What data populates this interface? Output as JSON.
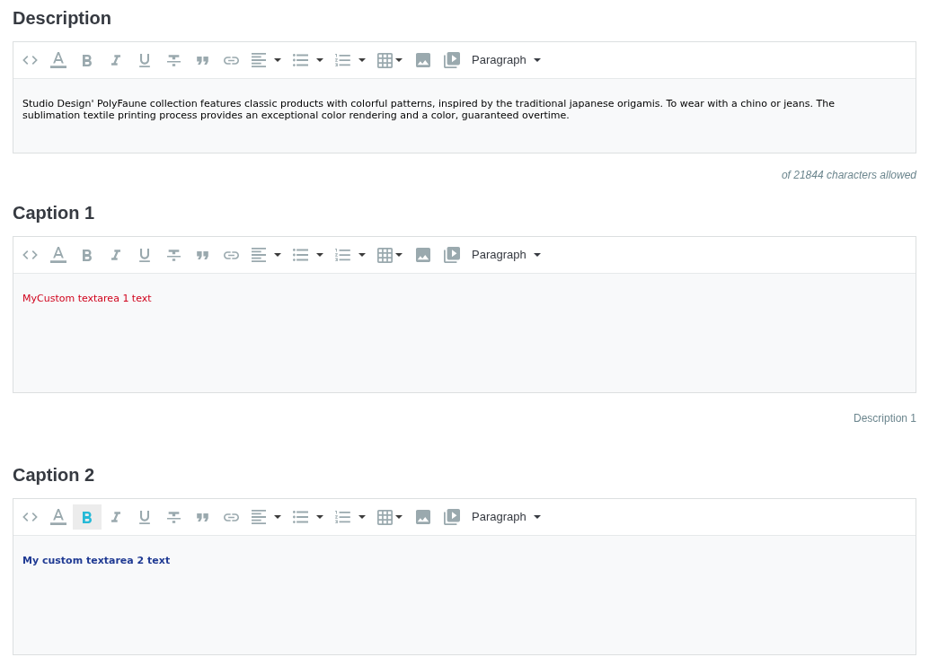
{
  "fields": [
    {
      "label": "Description",
      "toolbar": {
        "buttons": [
          {
            "kind": "code",
            "active": false
          },
          {
            "kind": "text-color",
            "active": false
          },
          {
            "kind": "bold",
            "active": false
          },
          {
            "kind": "italic",
            "active": false
          },
          {
            "kind": "underline",
            "active": false
          },
          {
            "kind": "strikethrough",
            "active": false
          },
          {
            "kind": "quote",
            "active": false
          },
          {
            "kind": "link",
            "active": false
          },
          {
            "kind": "align",
            "active": false
          },
          {
            "kind": "bullet-list",
            "active": false
          },
          {
            "kind": "numbered-list",
            "active": false
          },
          {
            "kind": "table",
            "active": false
          },
          {
            "kind": "image",
            "active": false
          },
          {
            "kind": "video",
            "active": false
          }
        ],
        "format": "Paragraph"
      },
      "content": {
        "text": "Studio Design' PolyFaune collection features classic products with colorful patterns, inspired by the traditional japanese origamis. To wear with a chino or jeans. The sublimation textile printing process provides an exceptional color rendering and a color, guaranteed overtime.",
        "color": "#000000",
        "bold": false
      },
      "note": {
        "kind": "counter",
        "text": "of 21844 characters allowed"
      }
    },
    {
      "label": "Caption 1",
      "toolbar": {
        "buttons": [
          {
            "kind": "code",
            "active": false
          },
          {
            "kind": "text-color",
            "active": false
          },
          {
            "kind": "bold",
            "active": false
          },
          {
            "kind": "italic",
            "active": false
          },
          {
            "kind": "underline",
            "active": false
          },
          {
            "kind": "strikethrough",
            "active": false
          },
          {
            "kind": "quote",
            "active": false
          },
          {
            "kind": "link",
            "active": false
          },
          {
            "kind": "align",
            "active": false
          },
          {
            "kind": "bullet-list",
            "active": false
          },
          {
            "kind": "numbered-list",
            "active": false
          },
          {
            "kind": "table",
            "active": false
          },
          {
            "kind": "image",
            "active": false
          },
          {
            "kind": "video",
            "active": false
          }
        ],
        "format": "Paragraph"
      },
      "content": {
        "text": "MyCustom textarea 1 text",
        "color": "#d0021b",
        "bold": false
      },
      "note": {
        "kind": "hint",
        "text": "Description 1"
      }
    },
    {
      "label": "Caption 2",
      "toolbar": {
        "buttons": [
          {
            "kind": "code",
            "active": false
          },
          {
            "kind": "text-color",
            "active": false
          },
          {
            "kind": "bold",
            "active": true
          },
          {
            "kind": "italic",
            "active": false
          },
          {
            "kind": "underline",
            "active": false
          },
          {
            "kind": "strikethrough",
            "active": false
          },
          {
            "kind": "quote",
            "active": false
          },
          {
            "kind": "link",
            "active": false
          },
          {
            "kind": "align",
            "active": false
          },
          {
            "kind": "bullet-list",
            "active": false
          },
          {
            "kind": "numbered-list",
            "active": false
          },
          {
            "kind": "table",
            "active": false
          },
          {
            "kind": "image",
            "active": false
          },
          {
            "kind": "video",
            "active": false
          }
        ],
        "format": "Paragraph"
      },
      "content": {
        "text": "My custom textarea 2 text",
        "color": "#1f3a93",
        "bold": true
      }
    }
  ]
}
